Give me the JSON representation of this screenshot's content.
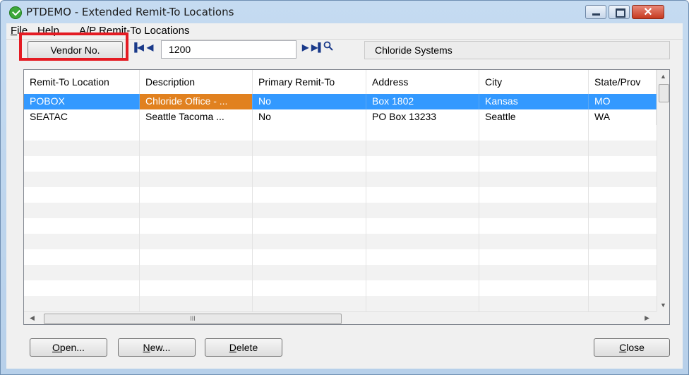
{
  "window": {
    "title": "PTDEMO - Extended Remit-To Locations",
    "controls": {
      "minimize": "–",
      "maximize": "□",
      "close": "✕"
    }
  },
  "menu": {
    "file": {
      "mnemonic": "F",
      "rest": "ile"
    },
    "help": {
      "mnemonic": "H",
      "rest": "elp"
    },
    "remit": "A/P Remit-To Locations"
  },
  "vendor": {
    "button_label": "Vendor No.",
    "number": "1200",
    "name": "Chloride Systems",
    "nav_icons": [
      "first-record-icon",
      "previous-record-icon",
      "next-record-icon",
      "last-record-icon",
      "search-icon"
    ]
  },
  "grid": {
    "columns": [
      "Remit-To Location",
      "Description",
      "Primary Remit-To",
      "Address",
      "City",
      "State/Prov"
    ],
    "rows": [
      [
        "POBOX",
        "Chloride Office - ...",
        "No",
        "Box 1802",
        "Kansas",
        "MO"
      ],
      [
        "SEATAC",
        "Seattle Tacoma ...",
        "No",
        "PO Box 13233",
        "Seattle",
        "WA"
      ]
    ],
    "selected_row": 0,
    "focused_cell": "Description",
    "hscroll_grip": "III"
  },
  "buttons": {
    "open": {
      "mnemonic": "O",
      "rest": "pen..."
    },
    "new": {
      "mnemonic": "N",
      "rest": "ew..."
    },
    "delete": {
      "mnemonic": "D",
      "rest": "elete"
    },
    "close": {
      "mnemonic": "C",
      "rest": "lose"
    }
  },
  "colors": {
    "selection": "#3399ff",
    "focused_cell": "#e1811f",
    "highlight_box": "#e41b23"
  }
}
